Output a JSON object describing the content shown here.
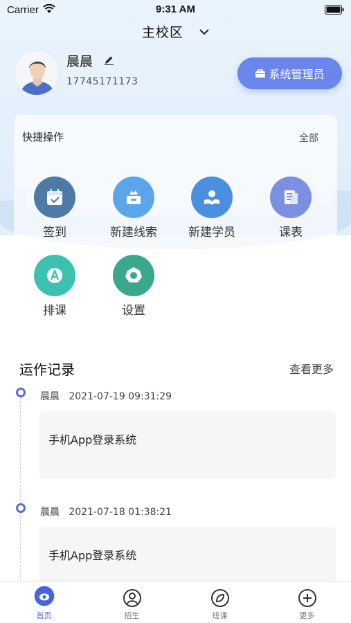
{
  "status_bar": {
    "carrier": "Carrier",
    "time": "9:31 AM"
  },
  "header": {
    "campus": "主校区"
  },
  "user": {
    "name": "晨晨",
    "phone": "17745171173",
    "role_button": "系统管理员"
  },
  "quick_actions": {
    "title": "快捷操作",
    "all_link": "全部",
    "items": [
      {
        "label": "签到",
        "icon": "calendar-check-icon",
        "color": "#4f7aa6"
      },
      {
        "label": "新建线索",
        "icon": "crown-box-icon",
        "color": "#5aa6e8"
      },
      {
        "label": "新建学员",
        "icon": "student-book-icon",
        "color": "#4b8fe0"
      },
      {
        "label": "课表",
        "icon": "document-icon",
        "color": "#7b90e0"
      },
      {
        "label": "排课",
        "icon": "letter-a-icon",
        "color": "#3cc0b0"
      },
      {
        "label": "设置",
        "icon": "gear-icon",
        "color": "#3aa88c"
      }
    ]
  },
  "operations": {
    "title": "运作记录",
    "more_link": "查看更多",
    "records": [
      {
        "user": "晨晨",
        "time": "2021-07-19 09:31:29",
        "text": "手机App登录系统"
      },
      {
        "user": "晨晨",
        "time": "2021-07-18 01:38:21",
        "text": "手机App登录系统"
      }
    ]
  },
  "tabbar": {
    "items": [
      {
        "label": "首页",
        "icon": "home-icon",
        "active": true
      },
      {
        "label": "招生",
        "icon": "user-circle-icon",
        "active": false
      },
      {
        "label": "班课",
        "icon": "compass-leaf-icon",
        "active": false
      },
      {
        "label": "更多",
        "icon": "plus-circle-icon",
        "active": false
      }
    ]
  },
  "colors": {
    "accent": "#6a86ec",
    "timeline_dot": "#5b6be0",
    "tab_active": "#4a63e0"
  }
}
